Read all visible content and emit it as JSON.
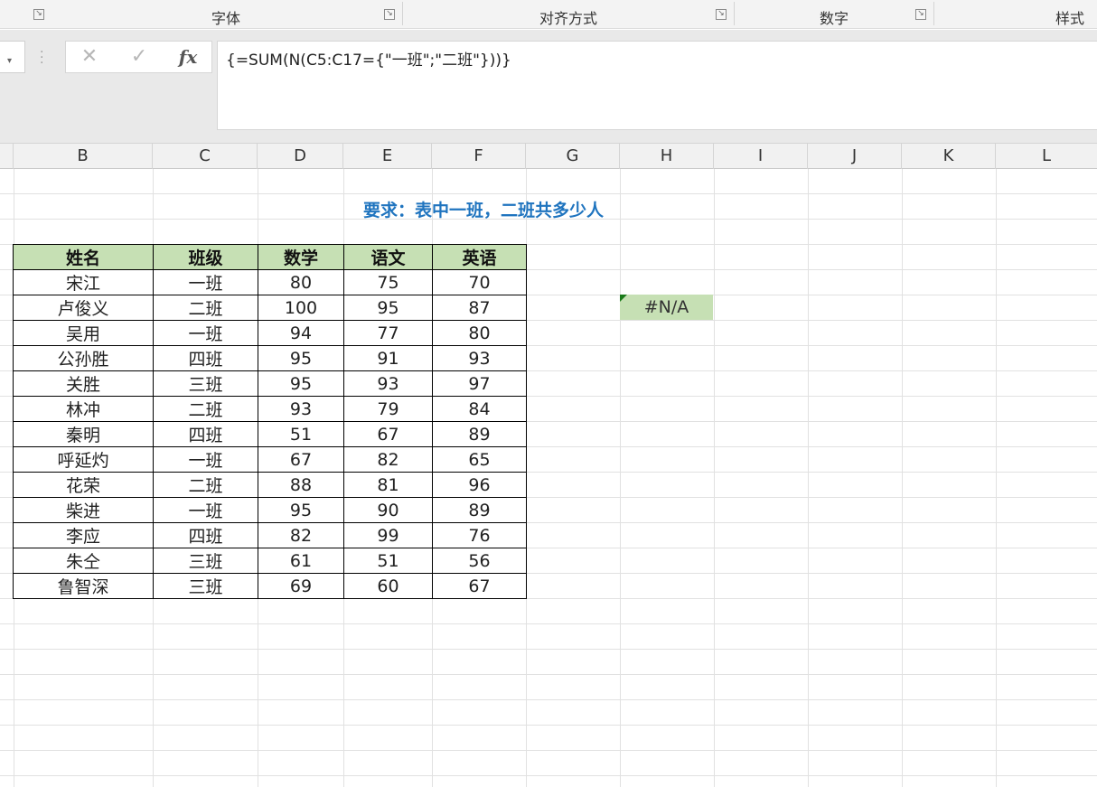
{
  "ribbon": {
    "groups": [
      {
        "label": "字体"
      },
      {
        "label": "对齐方式"
      },
      {
        "label": "数字"
      },
      {
        "label": "样式"
      }
    ]
  },
  "formula_bar": {
    "cancel_icon": "close-icon",
    "enter_icon": "check-icon",
    "fx_label": "fx",
    "formula": "{=SUM(N(C5:C17={\"一班\";\"二班\"}))}"
  },
  "columns": [
    "B",
    "C",
    "D",
    "E",
    "F",
    "G",
    "H",
    "I",
    "J",
    "K",
    "L"
  ],
  "sheet": {
    "title": "要求：表中一班，二班共多少人",
    "headers": [
      "姓名",
      "班级",
      "数学",
      "语文",
      "英语"
    ],
    "rows": [
      [
        "宋江",
        "一班",
        "80",
        "75",
        "70"
      ],
      [
        "卢俊义",
        "二班",
        "100",
        "95",
        "87"
      ],
      [
        "吴用",
        "一班",
        "94",
        "77",
        "80"
      ],
      [
        "公孙胜",
        "四班",
        "95",
        "91",
        "93"
      ],
      [
        "关胜",
        "三班",
        "95",
        "93",
        "97"
      ],
      [
        "林冲",
        "二班",
        "93",
        "79",
        "84"
      ],
      [
        "秦明",
        "四班",
        "51",
        "67",
        "89"
      ],
      [
        "呼延灼",
        "一班",
        "67",
        "82",
        "65"
      ],
      [
        "花荣",
        "二班",
        "88",
        "81",
        "96"
      ],
      [
        "柴进",
        "一班",
        "95",
        "90",
        "89"
      ],
      [
        "李应",
        "四班",
        "82",
        "99",
        "76"
      ],
      [
        "朱仝",
        "三班",
        "61",
        "51",
        "56"
      ],
      [
        "鲁智深",
        "三班",
        "69",
        "60",
        "67"
      ]
    ],
    "result": "#N/A"
  }
}
